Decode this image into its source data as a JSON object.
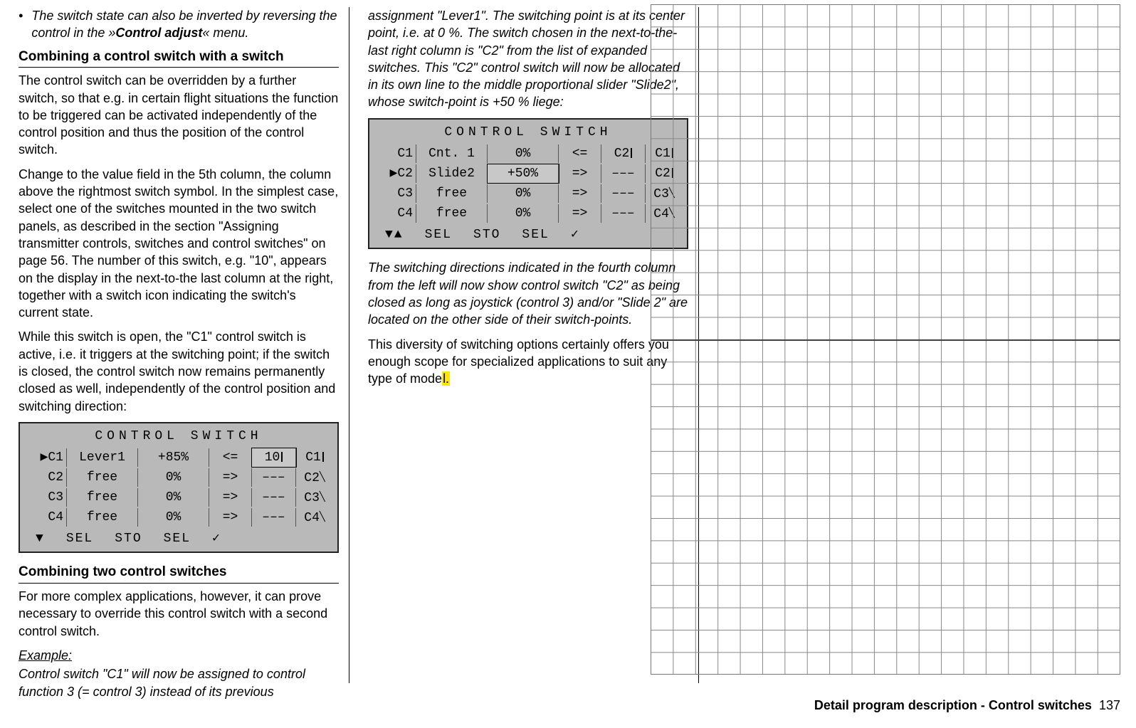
{
  "col1": {
    "bullet": "The switch state can also be inverted by reversing the control in the »",
    "bullet_bold": "Control adjust",
    "bullet_end": "« menu.",
    "h1": "Combining a control switch with a switch",
    "p1": "The control switch can be overridden by a further switch, so that e.g. in certain flight situations the function to be triggered can be activated independently of the control position and thus the position of the control switch.",
    "p2": "Change to the value field in the 5th column, the column above the rightmost switch symbol. In the simplest case, select one of the switches mounted in the two switch panels, as described in the section \"Assigning transmitter controls, switches and control switches\" on page 56. The number of this switch, e.g. \"10\", appears on the display in the next-to-the last column at the right, together with a switch icon indicating the switch's current state.",
    "p3": "While this switch is open, the \"C1\" control switch is active, i.e. it triggers at the switching point; if the switch is closed, the control switch now remains permanently closed as well, independently of the control position and switching direction:",
    "h2": "Combining two control switches",
    "p4": "For more complex applications, however, it can prove necessary to override this control switch with a second control switch.",
    "example": "Example:",
    "ex_p": "Control switch \"C1\" will now be assigned to control function 3 (= control 3) instead of its previous"
  },
  "lcd1": {
    "title": "CONTROL SWITCH",
    "rows": [
      {
        "sel": true,
        "c1": "C1",
        "c2": "Lever1",
        "c3": "+85%",
        "c4": "<=",
        "c5": "10",
        "c5b": true,
        "c6": "C1",
        "state": "closed"
      },
      {
        "sel": false,
        "c1": "C2",
        "c2": "free",
        "c3": "0%",
        "c4": "=>",
        "c5": "–––",
        "c6": "C2",
        "state": "open"
      },
      {
        "sel": false,
        "c1": "C3",
        "c2": "free",
        "c3": "0%",
        "c4": "=>",
        "c5": "–––",
        "c6": "C3",
        "state": "open"
      },
      {
        "sel": false,
        "c1": "C4",
        "c2": "free",
        "c3": "0%",
        "c4": "=>",
        "c5": "–––",
        "c6": "C4",
        "state": "open"
      }
    ],
    "footer": [
      "▼",
      "SEL",
      "STO",
      "SEL",
      "✓"
    ]
  },
  "col2": {
    "p1": "assignment \"Lever1\". The switching point is at its center point, i.e. at 0 %. The switch chosen in the next-to-the-last right column is \"C2\" from the list of expanded switches. This \"C2\" control switch will now be allocated in its own line to the middle proportional slider \"Slide2\", whose switch-point is +50 % liege:",
    "p2": "The switching directions indicated in the fourth column from the left will now show control switch \"C2\" as being closed as long as joystick (control 3) and/or \"Slide 2\" are located on the other side of their switch-points.",
    "p3a": "This diversity of switching options certainly offers you enough scope for specialized applications to suit any type of mode",
    "p3b": "l."
  },
  "lcd2": {
    "title": "CONTROL SWITCH",
    "rows": [
      {
        "sel": false,
        "c1": "C1",
        "c2": "Cnt. 1",
        "c3": "0%",
        "c4": "<=",
        "c5": "C2",
        "c5b": false,
        "c6": "C1",
        "state": "closed"
      },
      {
        "sel": true,
        "c1": "C2",
        "c2": "Slide2",
        "c3": "+50%",
        "c3b": true,
        "c4": "=>",
        "c5": "–––",
        "c6": "C2",
        "state": "closed"
      },
      {
        "sel": false,
        "c1": "C3",
        "c2": "free",
        "c3": "0%",
        "c4": "=>",
        "c5": "–––",
        "c6": "C3",
        "state": "open"
      },
      {
        "sel": false,
        "c1": "C4",
        "c2": "free",
        "c3": "0%",
        "c4": "=>",
        "c5": "–––",
        "c6": "C4",
        "state": "open"
      }
    ],
    "footer": [
      "▼▲",
      "SEL",
      "STO",
      "SEL",
      "✓"
    ]
  },
  "page_footer": {
    "label": "Detail program description - Control switches",
    "num": "137"
  }
}
